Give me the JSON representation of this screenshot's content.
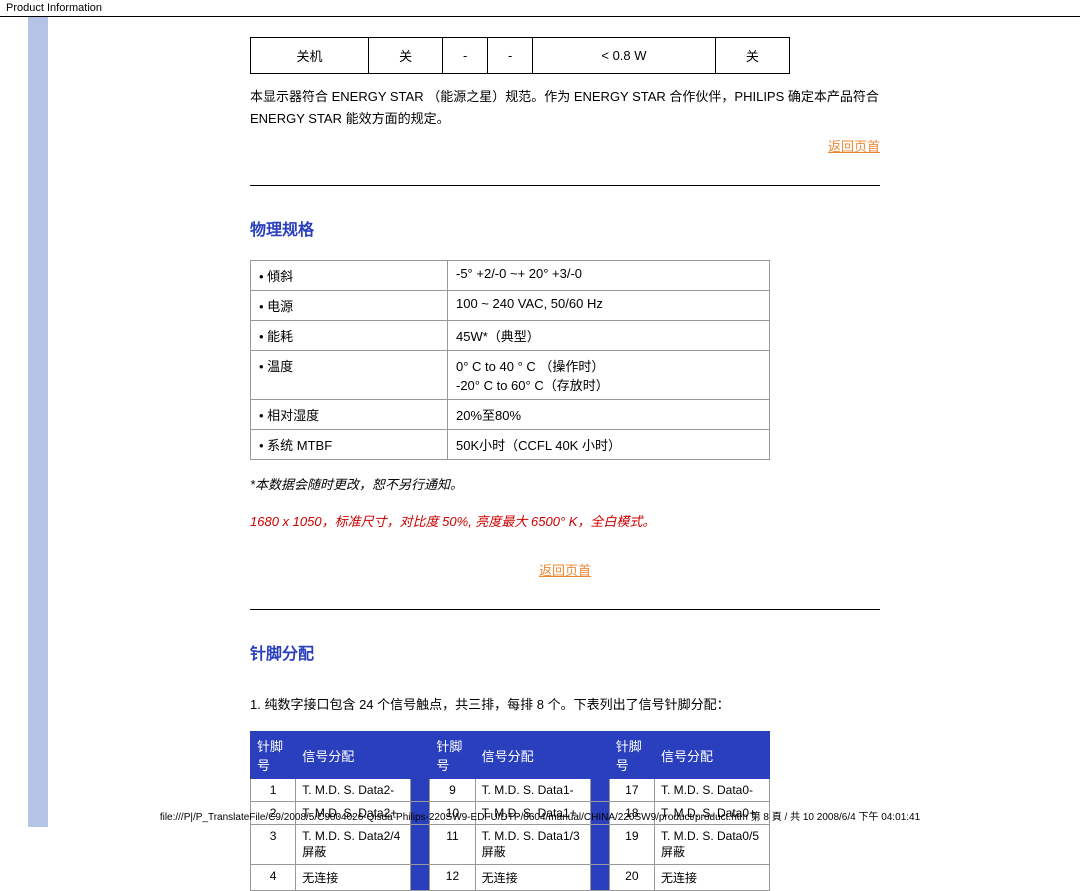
{
  "header_title": "Product Information",
  "power_row": [
    "关机",
    "关",
    "-",
    "-",
    "< 0.8 W",
    "关"
  ],
  "energy_para": "本显示器符合 ENERGY STAR （能源之星）规范。作为 ENERGY STAR  合作伙伴，PHILIPS 确定本产品符合 ENERGY STAR  能效方面的规定。",
  "back_top": "返回页首",
  "sec_phys": "物理规格",
  "spec_rows": [
    {
      "k": "• 傾斜",
      "v": "-5° +2/-0 ~+ 20° +3/-0"
    },
    {
      "k": "• 电源",
      "v": "100 ~ 240 VAC,  50/60 Hz"
    },
    {
      "k": "• 能耗",
      "v": "45W*（典型）"
    },
    {
      "k": "• 温度",
      "v": "0° C to 40 ° C （操作时）\n-20° C to 60° C（存放时）"
    },
    {
      "k": "• 相对湿度",
      "v": "20%至80%"
    },
    {
      "k": "• 系统 MTBF",
      "v": "50K小时（CCFL 40K 小时）"
    }
  ],
  "note1": "*本数据会随时更改，恕不另行通知。",
  "note2": "1680 x 1050，标准尺寸，对比度 50%, 亮度最大 6500° K，全白模式。",
  "sec_pins": "针脚分配",
  "pins_para": "1. 纯数字接口包含 24 个信号触点，共三排，每排 8 个。下表列出了信号针脚分配：",
  "pins_header": [
    "针脚号",
    "信号分配",
    "针脚号",
    "信号分配",
    "针脚号",
    "信号分配"
  ],
  "pins_rows": [
    [
      "1",
      "T. M.D. S. Data2-",
      "9",
      "T. M.D. S.  Data1-",
      "17",
      "T. M.D. S. Data0-"
    ],
    [
      "2",
      "T. M.D. S.  Data2+",
      "10",
      "T. M.D. S.  Data1+",
      "18",
      "T. M.D. S.  Data0+"
    ],
    [
      "3",
      "T. M.D. S. Data2/4 屏蔽",
      "11",
      "T. M.D. S. Data1/3 屏蔽",
      "19",
      "T. M.D. S. Data0/5 屏蔽"
    ],
    [
      "4",
      "无连接",
      "12",
      "无连接",
      "20",
      "无连接"
    ]
  ],
  "footer": "file:///P|/P_TranslateFile/C9/2008/5/C9004026-Qisda-Philips-220SW9-EDFU/DTP/0604/manual/CHINA/220SW9/product/product.htm 第 8 頁 / 共 10 2008/6/4 下午 04:01:41"
}
